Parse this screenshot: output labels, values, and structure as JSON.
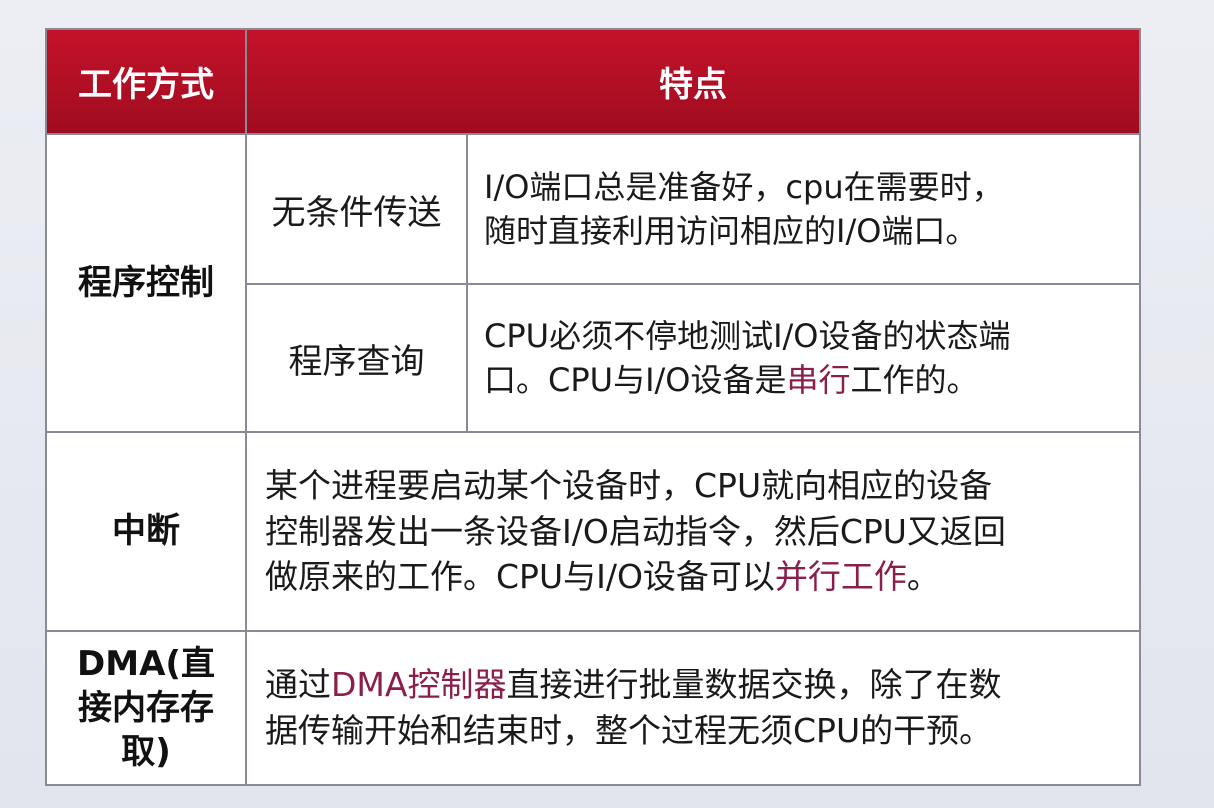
{
  "header": {
    "col_mode": "工作方式",
    "col_features": "特点"
  },
  "rows": {
    "program_control": {
      "label": "程序控制",
      "unconditional": {
        "label": "无条件传送",
        "line1": "I/O端口总是准备好，cpu在需要时，",
        "line2": "随时直接利用访问相应的I/O端口。"
      },
      "polling": {
        "label": "程序查询",
        "line1": "CPU必须不停地测试I/O设备的状态端",
        "line2_a": "口。CPU与I/O设备是",
        "line2_hl": "串行",
        "line2_b": "工作的。"
      }
    },
    "interrupt": {
      "label": "中断",
      "line1": "某个进程要启动某个设备时，CPU就向相应的设备",
      "line2": "控制器发出一条设备I/O启动指令，然后CPU又返回",
      "line3_a": "做原来的工作。CPU与I/O设备可以",
      "line3_hl": "并行工作",
      "line3_b": "。"
    },
    "dma": {
      "label_line1": "DMA(直",
      "label_line2": "接内存存",
      "label_line3": "取)",
      "line1_a": "通过",
      "line1_hl": "DMA控制器",
      "line1_b": "直接进行批量数据交换，除了在数",
      "line2": "据传输开始和结束时，整个过程无须CPU的干预。"
    }
  },
  "colors": {
    "header_bg": "#b3102a",
    "highlight": "#8b1f4c",
    "border": "#8a8a94"
  }
}
